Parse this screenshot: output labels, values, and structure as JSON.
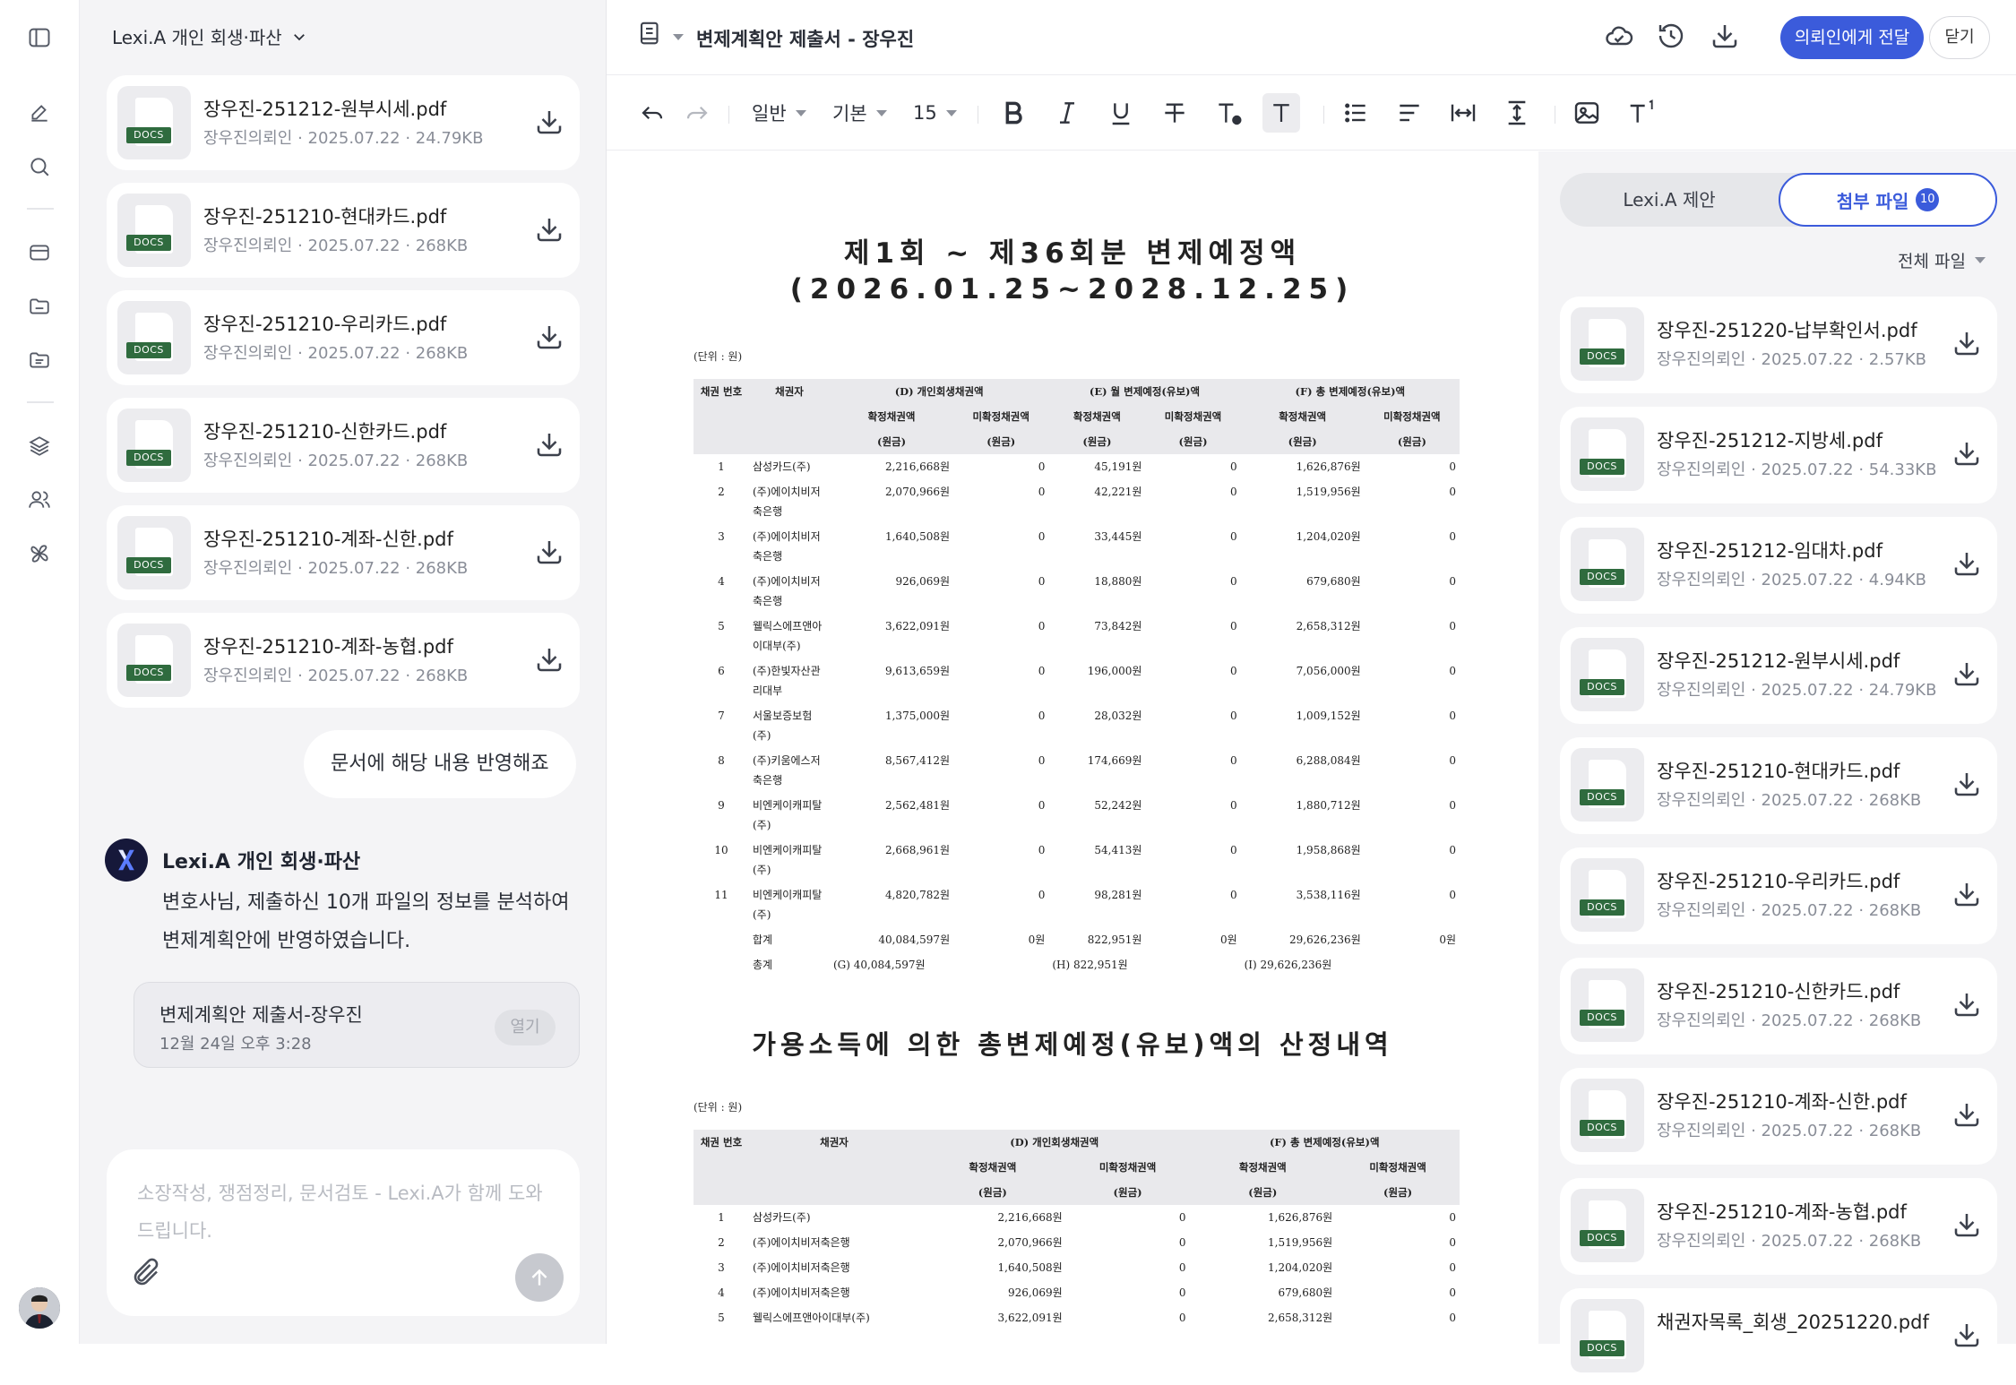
{
  "sidebar": {
    "icons": [
      "sidebar-toggle-icon",
      "edit-icon",
      "search-icon",
      "card-icon",
      "folder-icon",
      "folder-stack-icon",
      "layers-icon",
      "users-icon",
      "pinwheel-icon"
    ]
  },
  "chat": {
    "project_title": "Lexi.A 개인 회생·파산",
    "files": [
      {
        "name": "장우진-251212-원부시세.pdf",
        "owner": "장우진의뢰인",
        "date": "2025.07.22",
        "size": "24.79KB",
        "tag": "DOCS"
      },
      {
        "name": "장우진-251210-현대카드.pdf",
        "owner": "장우진의뢰인",
        "date": "2025.07.22",
        "size": "268KB",
        "tag": "DOCS"
      },
      {
        "name": "장우진-251210-우리카드.pdf",
        "owner": "장우진의뢰인",
        "date": "2025.07.22",
        "size": "268KB",
        "tag": "DOCS"
      },
      {
        "name": "장우진-251210-신한카드.pdf",
        "owner": "장우진의뢰인",
        "date": "2025.07.22",
        "size": "268KB",
        "tag": "DOCS"
      },
      {
        "name": "장우진-251210-계좌-신한.pdf",
        "owner": "장우진의뢰인",
        "date": "2025.07.22",
        "size": "268KB",
        "tag": "DOCS"
      },
      {
        "name": "장우진-251210-계좌-농협.pdf",
        "owner": "장우진의뢰인",
        "date": "2025.07.22",
        "size": "268KB",
        "tag": "DOCS"
      }
    ],
    "user_message": "문서에 해당 내용 반영해죠",
    "bot_name": "Lexi.A 개인 회생·파산",
    "bot_message": "변호사님, 제출하신 10개 파일의 정보를 분석하여 변제계획안에 반영하였습니다.",
    "doc_card": {
      "title": "변제계획안 제출서-장우진",
      "date": "12월 24일 오후 3:28",
      "open_label": "열기"
    },
    "composer_placeholder": "소장작성, 쟁점정리, 문서검토 - Lexi.A가 함께 도와드립니다."
  },
  "editor": {
    "doc_title": "변제계획안 제출서 - 장우진",
    "forward_label": "의뢰인에게 전달",
    "close_label": "닫기",
    "toolbar": {
      "style": "일반",
      "font": "기본",
      "size": "15"
    },
    "doc": {
      "title1": "제1회 ~ 제36회분 변제예정액",
      "title2": "(2026.01.25~2028.12.25)",
      "unit": "(단위 : 원)",
      "t1_headers": {
        "no": "채권 번호",
        "creditor": "채권자",
        "d": "(D) 개인회생채권액",
        "e": "(E) 월 변제예정(유보)액",
        "f": "(F) 총 변제예정(유보)액",
        "confirmed": "확정채권액",
        "unconfirmed": "미확정채권액",
        "won": "(원금)"
      },
      "t1_rows": [
        [
          "1",
          "삼성카드(주)",
          "2,216,668원",
          "0",
          "45,191원",
          "0",
          "1,626,876원",
          "0"
        ],
        [
          "2",
          "(주)에이치비저축은행",
          "2,070,966원",
          "0",
          "42,221원",
          "0",
          "1,519,956원",
          "0"
        ],
        [
          "3",
          "(주)에이치비저축은행",
          "1,640,508원",
          "0",
          "33,445원",
          "0",
          "1,204,020원",
          "0"
        ],
        [
          "4",
          "(주)에이치비저축은행",
          "926,069원",
          "0",
          "18,880원",
          "0",
          "679,680원",
          "0"
        ],
        [
          "5",
          "웰릭스에프앤아이대부(주)",
          "3,622,091원",
          "0",
          "73,842원",
          "0",
          "2,658,312원",
          "0"
        ],
        [
          "6",
          "(주)한빛자산관리대부",
          "9,613,659원",
          "0",
          "196,000원",
          "0",
          "7,056,000원",
          "0"
        ],
        [
          "7",
          "서울보증보험(주)",
          "1,375,000원",
          "0",
          "28,032원",
          "0",
          "1,009,152원",
          "0"
        ],
        [
          "8",
          "(주)키움에스저축은행",
          "8,567,412원",
          "0",
          "174,669원",
          "0",
          "6,288,084원",
          "0"
        ],
        [
          "9",
          "비엔케이캐피탈(주)",
          "2,562,481원",
          "0",
          "52,242원",
          "0",
          "1,880,712원",
          "0"
        ],
        [
          "10",
          "비엔케이캐피탈(주)",
          "2,668,961원",
          "0",
          "54,413원",
          "0",
          "1,958,868원",
          "0"
        ],
        [
          "11",
          "비엔케이캐피탈(주)",
          "4,820,782원",
          "0",
          "98,281원",
          "0",
          "3,538,116원",
          "0"
        ]
      ],
      "t1_sum": {
        "label": "합계",
        "d1": "40,084,597원",
        "d2": "0원",
        "e1": "822,951원",
        "e2": "0원",
        "f1": "29,626,236원",
        "f2": "0원"
      },
      "t1_total": {
        "label": "총계",
        "g": "(G)  40,084,597원",
        "h": "(H)  822,951원",
        "i": "(I)  29,626,236원"
      },
      "section2_title": "가용소득에 의한 총변제예정(유보)액의 산정내역",
      "t2_headers": {
        "no": "채권 번호",
        "creditor": "채권자",
        "d": "(D) 개인회생채권액",
        "f": "(F) 총 변제예정(유보)액",
        "confirmed": "확정채권액",
        "unconfirmed": "미확정채권액",
        "won": "(원금)"
      },
      "t2_rows": [
        [
          "1",
          "삼성카드(주)",
          "2,216,668원",
          "0",
          "1,626,876원",
          "0"
        ],
        [
          "2",
          "(주)에이치비저축은행",
          "2,070,966원",
          "0",
          "1,519,956원",
          "0"
        ],
        [
          "3",
          "(주)에이치비저축은행",
          "1,640,508원",
          "0",
          "1,204,020원",
          "0"
        ],
        [
          "4",
          "(주)에이치비저축은행",
          "926,069원",
          "0",
          "679,680원",
          "0"
        ],
        [
          "5",
          "웰릭스에프앤아이대부(주)",
          "3,622,091원",
          "0",
          "2,658,312원",
          "0"
        ]
      ]
    },
    "panel": {
      "tab_suggestions": "Lexi.A 제안",
      "tab_files": "첨부 파일",
      "files_count": "10",
      "filter_label": "전체 파일",
      "files": [
        {
          "name": "장우진-251220-납부확인서.pdf",
          "owner": "장우진의뢰인",
          "date": "2025.07.22",
          "size": "2.57KB",
          "tag": "DOCS"
        },
        {
          "name": "장우진-251212-지방세.pdf",
          "owner": "장우진의뢰인",
          "date": "2025.07.22",
          "size": "54.33KB",
          "tag": "DOCS"
        },
        {
          "name": "장우진-251212-임대차.pdf",
          "owner": "장우진의뢰인",
          "date": "2025.07.22",
          "size": "4.94KB",
          "tag": "DOCS"
        },
        {
          "name": "장우진-251212-원부시세.pdf",
          "owner": "장우진의뢰인",
          "date": "2025.07.22",
          "size": "24.79KB",
          "tag": "DOCS"
        },
        {
          "name": "장우진-251210-현대카드.pdf",
          "owner": "장우진의뢰인",
          "date": "2025.07.22",
          "size": "268KB",
          "tag": "DOCS"
        },
        {
          "name": "장우진-251210-우리카드.pdf",
          "owner": "장우진의뢰인",
          "date": "2025.07.22",
          "size": "268KB",
          "tag": "DOCS"
        },
        {
          "name": "장우진-251210-신한카드.pdf",
          "owner": "장우진의뢰인",
          "date": "2025.07.22",
          "size": "268KB",
          "tag": "DOCS"
        },
        {
          "name": "장우진-251210-계좌-신한.pdf",
          "owner": "장우진의뢰인",
          "date": "2025.07.22",
          "size": "268KB",
          "tag": "DOCS"
        },
        {
          "name": "장우진-251210-계좌-농협.pdf",
          "owner": "장우진의뢰인",
          "date": "2025.07.22",
          "size": "268KB",
          "tag": "DOCS"
        },
        {
          "name": "채권자목록_회생_20251220.pdf",
          "owner": "",
          "date": "",
          "size": "",
          "tag": "DOCS"
        }
      ]
    }
  },
  "colors": {
    "accent": "#3b5bdb",
    "docs_tag": "#2f6b3e",
    "panel_bg": "#f4f4f6"
  }
}
